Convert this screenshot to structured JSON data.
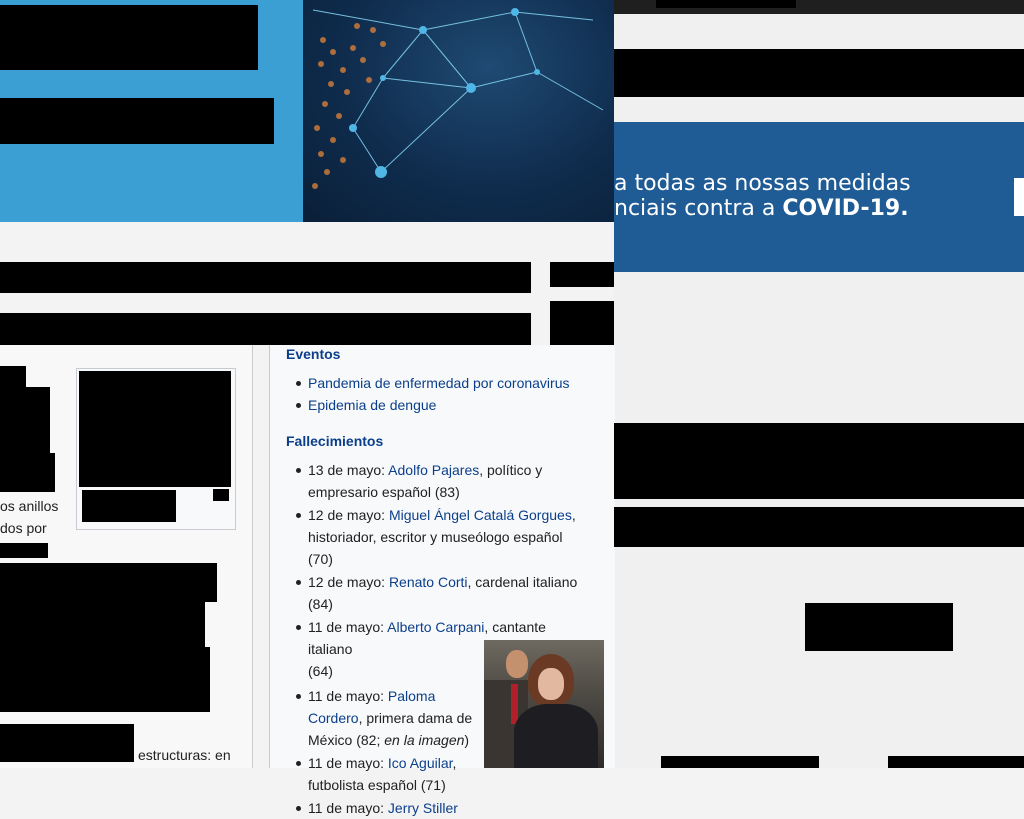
{
  "covid_banner": {
    "line1": "a todas as nossas medidas",
    "line2_prefix": "nciais contra a ",
    "line2_strong": "COVID-19."
  },
  "left_fragments": {
    "line1": "os anillos",
    "line2": "dos por",
    "line3": "estructuras: en"
  },
  "events": {
    "heading": "Eventos",
    "items": [
      "Pandemia de enfermedad por coronavirus",
      "Epidemia de dengue"
    ]
  },
  "deaths": {
    "heading": "Fallecimientos",
    "items": [
      {
        "date": "13 de mayo: ",
        "link": "Adolfo Pajares",
        "rest": ", político y",
        "rest2": "empresario español (83)"
      },
      {
        "date": "12 de mayo: ",
        "link": "Miguel Ángel Catalá Gorgues",
        "rest": ",",
        "rest2": "historiador, escritor y museólogo español (70)"
      },
      {
        "date": "12 de mayo: ",
        "link": "Renato Corti",
        "rest": ", cardenal italiano",
        "rest2": "(84)"
      },
      {
        "date": "11 de mayo: ",
        "link": "Alberto Carpani",
        "rest": ", cantante italiano",
        "rest2": "(64)"
      },
      {
        "date": "11 de mayo: ",
        "link": "Paloma",
        "rest": "",
        "link2": "Cordero",
        "rest2": ", primera dama de",
        "rest3": "México (82; ",
        "ital": "en la imagen",
        "rest4": ")"
      },
      {
        "date": "11 de mayo: ",
        "link": "Ico Aguilar",
        "rest": ",",
        "rest2": "futbolista español (71)"
      },
      {
        "date": "11 de mayo: ",
        "link": "Jerry Stiller"
      }
    ]
  }
}
